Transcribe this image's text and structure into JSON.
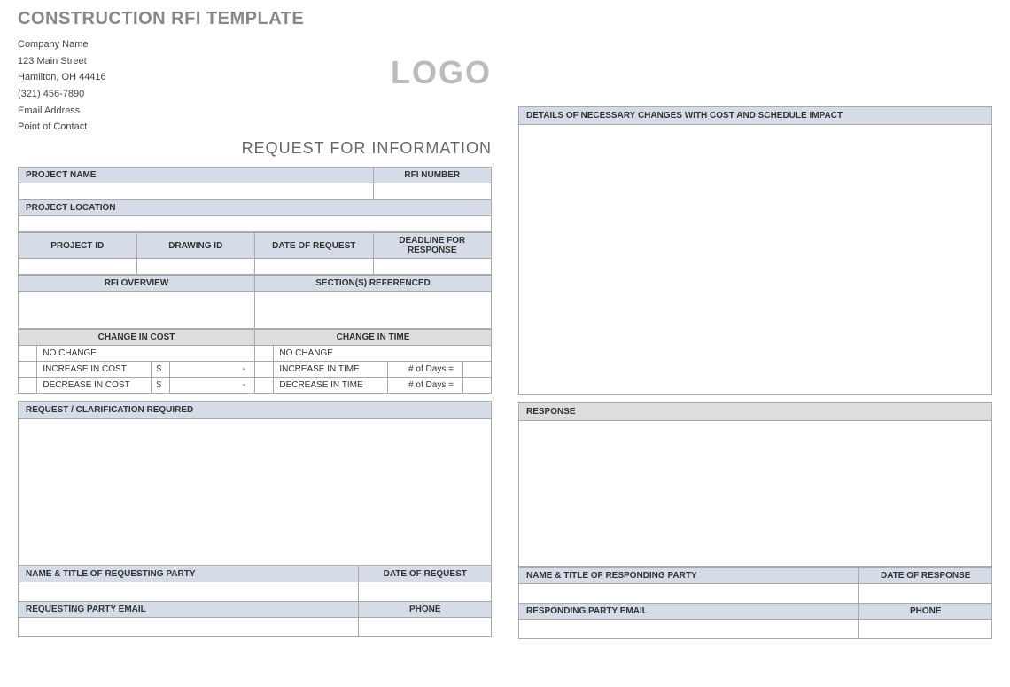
{
  "doc": {
    "title": "CONSTRUCTION RFI TEMPLATE",
    "company": {
      "name": "Company Name",
      "street": "123 Main Street",
      "city_state_zip": "Hamilton, OH 44416",
      "phone": "(321) 456-7890",
      "email": "Email Address",
      "contact": "Point of Contact"
    },
    "logo_text": "LOGO",
    "rfi_title": "REQUEST FOR INFORMATION"
  },
  "headers": {
    "project_name": "PROJECT NAME",
    "rfi_number": "RFI NUMBER",
    "project_location": "PROJECT LOCATION",
    "project_id": "PROJECT ID",
    "drawing_id": "DRAWING ID",
    "date_of_request": "DATE OF REQUEST",
    "deadline": "DEADLINE FOR RESPONSE",
    "rfi_overview": "RFI OVERVIEW",
    "sections_ref": "SECTION(S) REFERENCED",
    "change_cost": "CHANGE IN COST",
    "change_time": "CHANGE IN TIME"
  },
  "change_cost": {
    "no_change": "NO CHANGE",
    "increase": "INCREASE IN COST",
    "decrease": "DECREASE IN COST",
    "symbol": "$",
    "dash": "-"
  },
  "change_time": {
    "no_change": "NO CHANGE",
    "increase": "INCREASE IN TIME",
    "decrease": "DECREASE IN TIME",
    "days_label": "# of Days ="
  },
  "sections": {
    "request_clarification": "REQUEST / CLARIFICATION REQUIRED",
    "details_changes": "DETAILS OF NECESSARY CHANGES WITH COST AND SCHEDULE IMPACT",
    "response": "RESPONSE"
  },
  "requesting": {
    "name_title": "NAME & TITLE OF REQUESTING PARTY",
    "date": "DATE OF REQUEST",
    "email": "REQUESTING PARTY EMAIL",
    "phone": "PHONE"
  },
  "responding": {
    "name_title": "NAME & TITLE OF RESPONDING PARTY",
    "date": "DATE OF RESPONSE",
    "email": "RESPONDING PARTY EMAIL",
    "phone": "PHONE"
  }
}
